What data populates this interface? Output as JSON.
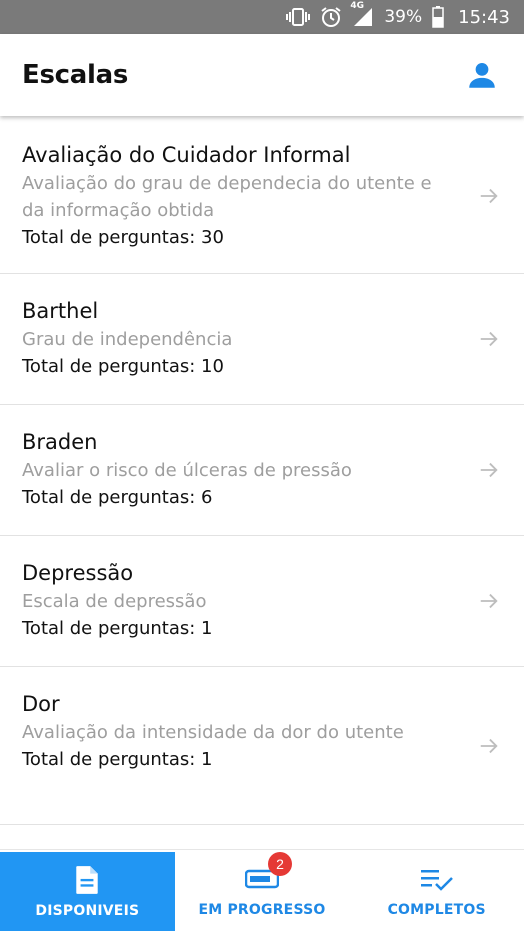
{
  "status_bar": {
    "network": "4G",
    "battery": "39%",
    "time": "15:43"
  },
  "header": {
    "title": "Escalas",
    "profile_icon": "person-icon"
  },
  "scales": [
    {
      "title": "Avaliação do Cuidador Informal",
      "description": "Avaliação do grau de dependecia do utente e da informação obtida",
      "total": "Total de perguntas: 30"
    },
    {
      "title": "Barthel",
      "description": "Grau de independência",
      "total": "Total de perguntas: 10"
    },
    {
      "title": "Braden",
      "description": "Avaliar o risco de úlceras de pressão",
      "total": "Total de perguntas: 6"
    },
    {
      "title": "Depressão",
      "description": "Escala de depressão",
      "total": "Total de perguntas: 1"
    },
    {
      "title": "Dor",
      "description": "Avaliação da intensidade da dor do utente",
      "total": "Total de perguntas: 1"
    }
  ],
  "bottom_nav": {
    "tabs": [
      {
        "label": "DISPONIVEIS",
        "icon": "document-icon",
        "active": true
      },
      {
        "label": "EM PROGRESSO",
        "icon": "progress-bar-icon",
        "badge": "2",
        "active": false
      },
      {
        "label": "COMPLETOS",
        "icon": "checklist-icon",
        "active": false
      }
    ]
  },
  "colors": {
    "accent": "#2196f3",
    "badge": "#e53935",
    "secondary_text": "#9e9e9e",
    "status_bar": "#7a7a7a"
  }
}
